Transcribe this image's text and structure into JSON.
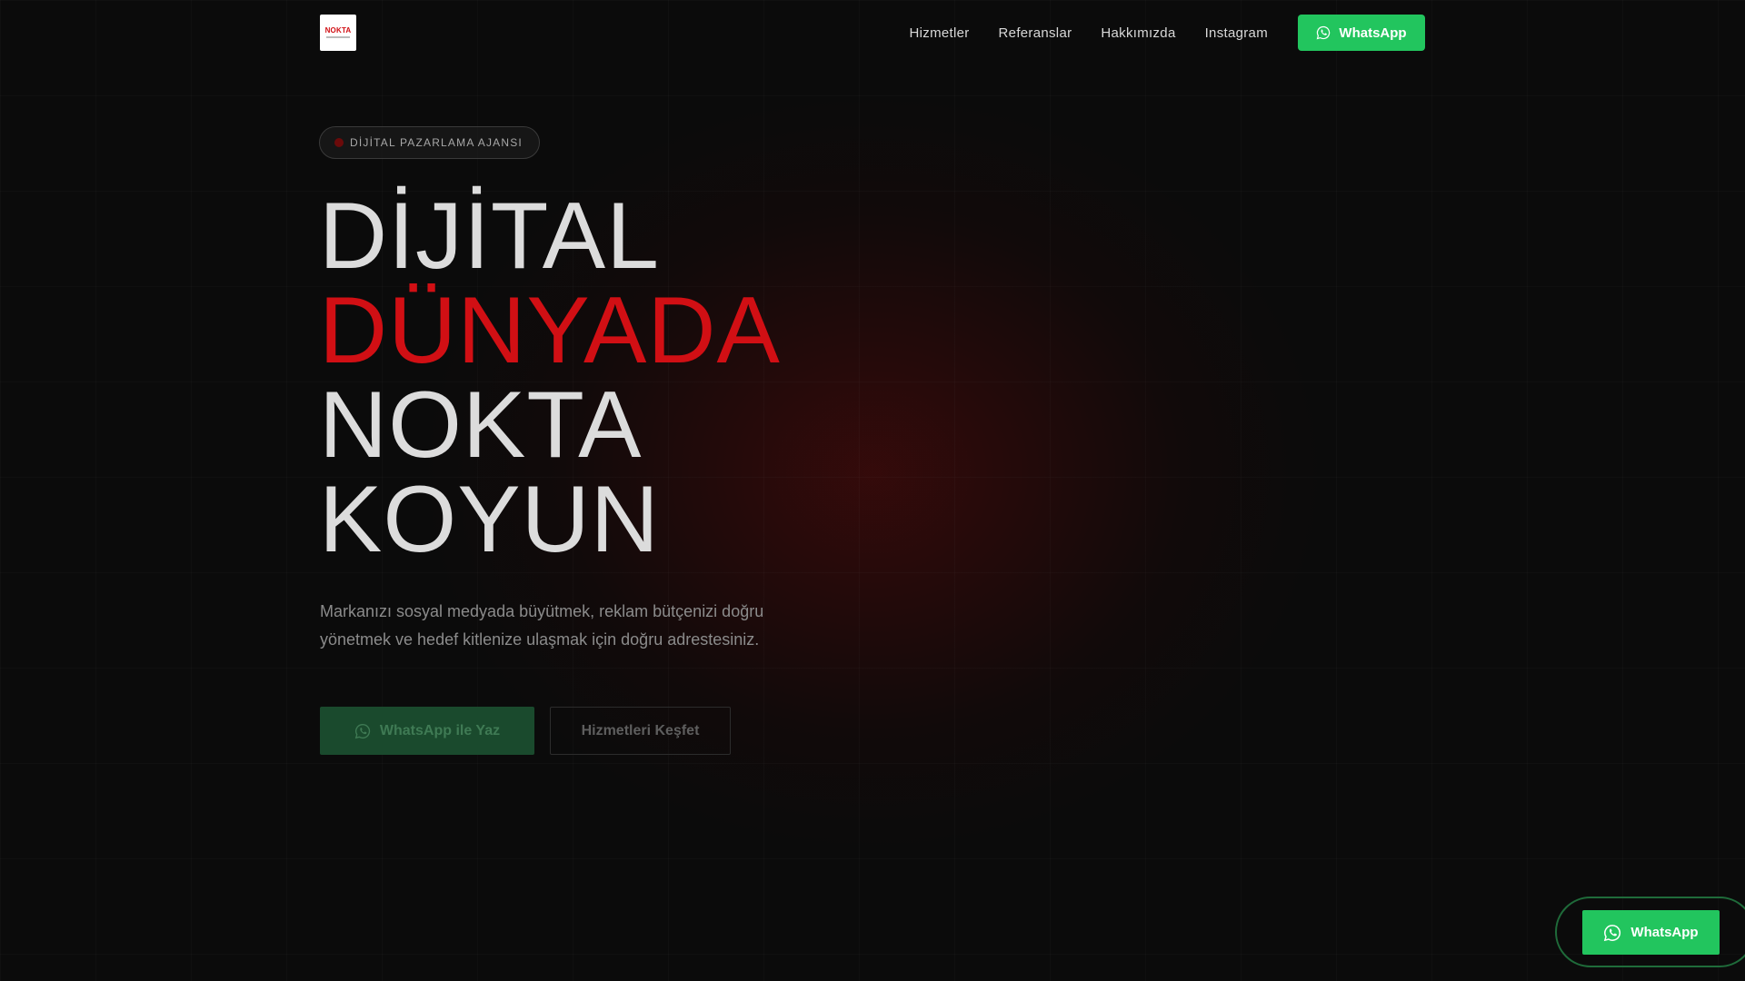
{
  "header": {
    "logo_text": "NOKTA",
    "nav": [
      "Hizmetler",
      "Referanslar",
      "Hakkımızda",
      "Instagram"
    ],
    "whatsapp_label": "WhatsApp"
  },
  "hero": {
    "badge": "DİJİTAL PAZARLAMA AJANSI",
    "headline": [
      "DİJİTAL",
      "DÜNYADA",
      "NOKTA",
      "KOYUN"
    ],
    "subtitle_line1": "Markanızı sosyal medyada büyütmek, reklam bütçenizi doğru",
    "subtitle_line2": "yönetmek ve hedef kitlenize ulaşmak için doğru adrestesiniz.",
    "cta_whatsapp": "WhatsApp ile Yaz",
    "cta_explore": "Hizmetleri Keşfet"
  },
  "floating": {
    "whatsapp_label": "WhatsApp"
  },
  "colors": {
    "accent_red": "#d10f14",
    "whatsapp_green": "#22c55e",
    "background": "#0b0b0b"
  },
  "icons": {
    "whatsapp": "whatsapp-icon"
  }
}
